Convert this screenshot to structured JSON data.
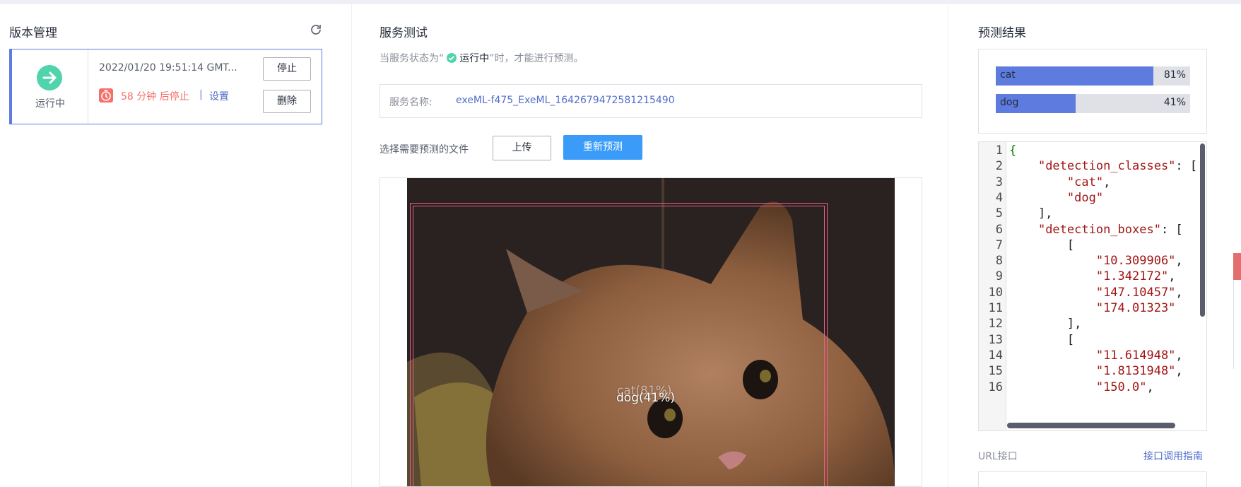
{
  "versions": {
    "title": "版本管理",
    "card": {
      "status": "运行中",
      "time": "2022/01/20 19:51:14 GMT...",
      "stop_countdown": "58 分钟 后停止",
      "separator": "|",
      "setting_link": "设置",
      "stop_button": "停止",
      "delete_button": "删除"
    }
  },
  "service_test": {
    "title": "服务测试",
    "hint_prefix": "当服务状态为“",
    "hint_status": "运行中",
    "hint_suffix": "”时，才能进行预测。",
    "service_name_label": "服务名称:",
    "service_name_value": "exeML-f475_ExeML_1642679472581215490",
    "select_file_label": "选择需要预测的文件",
    "upload_button": "上传",
    "repredict_button": "重新预测",
    "detections": [
      {
        "label": "cat(81%)"
      },
      {
        "label": "dog(41%)"
      }
    ]
  },
  "results": {
    "title": "预测结果",
    "bars": [
      {
        "name": "cat",
        "percent": "81%",
        "value": 0.81
      },
      {
        "name": "dog",
        "percent": "41%",
        "value": 0.41
      }
    ],
    "code_lines": [
      "{",
      "    \"detection_classes\": [",
      "        \"cat\",",
      "        \"dog\"",
      "    ],",
      "    \"detection_boxes\": [",
      "        [",
      "            \"10.309906\",",
      "            \"1.342172\",",
      "            \"147.10457\",",
      "            \"174.01323\"",
      "        ],",
      "        [",
      "            \"11.614948\",",
      "            \"1.8131948\",",
      "            \"150.0\","
    ],
    "url_label": "URL接口",
    "api_guide_link": "接口调用指南"
  },
  "colors": {
    "accent": "#5e7ce0",
    "running_green": "#50d4ab",
    "warning_red": "#f66f6a",
    "primary_button": "#3a9cf8",
    "bbox": "#e85f87"
  }
}
